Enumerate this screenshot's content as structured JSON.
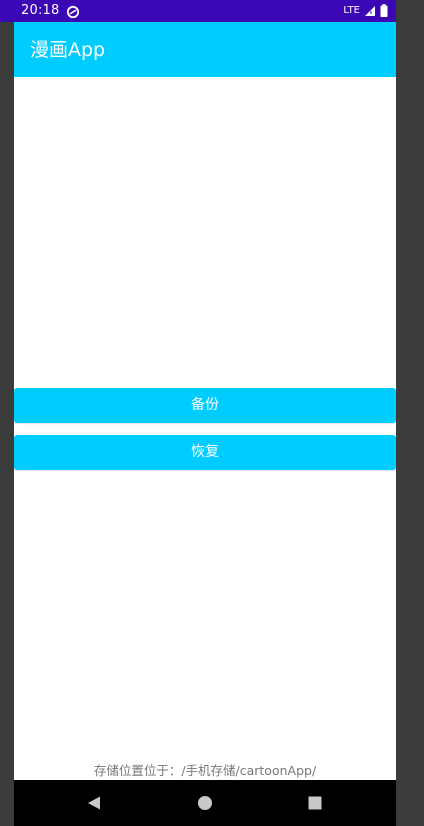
{
  "status_bar": {
    "time": "20:18",
    "network": "LTE",
    "app_icon": "sync-icon",
    "signal_icon": "signal-icon",
    "battery_icon": "battery-icon"
  },
  "app_bar": {
    "title": "漫画App"
  },
  "actions": {
    "backup_label": "备份",
    "restore_label": "恢复"
  },
  "footer": {
    "storage_note": "存储位置位于：/手机存储/cartoonApp/"
  },
  "nav_bar": {
    "back_icon": "back-triangle-icon",
    "home_icon": "home-circle-icon",
    "recents_icon": "recents-square-icon"
  },
  "colors": {
    "status_bar": "#3b06b3",
    "accent": "#00ccff",
    "nav_bar": "#000000",
    "frame": "#3a3c3c"
  }
}
